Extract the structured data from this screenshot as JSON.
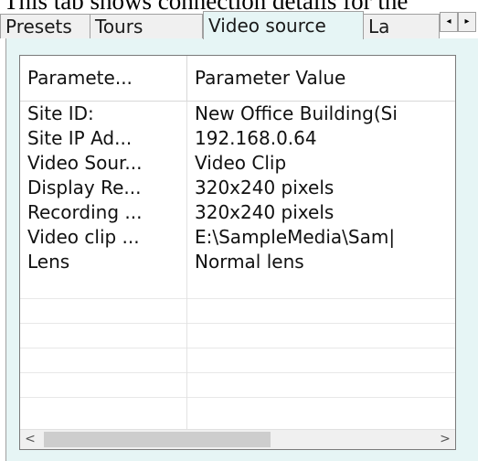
{
  "caption": "This tab shows connection details for the",
  "tabs": [
    {
      "label": "Presets"
    },
    {
      "label": "Tours"
    },
    {
      "label": "Video source"
    },
    {
      "label": "La"
    }
  ],
  "table": {
    "headers": [
      "Paramete...",
      "Parameter Value"
    ],
    "rows": [
      [
        "Site ID:",
        "New Office Building(Si"
      ],
      [
        "Site IP Ad...",
        "192.168.0.64"
      ],
      [
        "Video Sour...",
        "Video Clip"
      ],
      [
        "Display Re...",
        "320x240 pixels"
      ],
      [
        "Recording ...",
        "320x240 pixels"
      ],
      [
        "Video clip ...",
        "E:\\SampleMedia\\Sam|"
      ],
      [
        "Lens",
        "Normal lens"
      ]
    ]
  },
  "icons": {
    "tab_scroll_left": "◂",
    "tab_scroll_right": "▸",
    "scroll_left": "<",
    "scroll_right": ">"
  }
}
